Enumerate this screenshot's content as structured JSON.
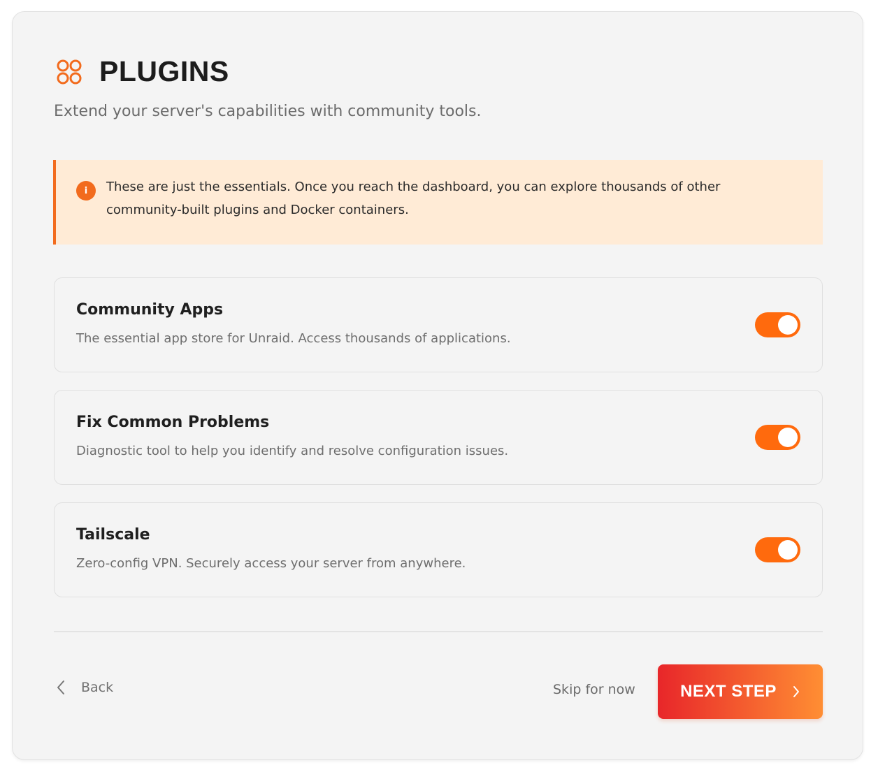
{
  "header": {
    "title": "PLUGINS",
    "icon": "apps-grid-icon",
    "subtitle": "Extend your server's capabilities with community tools."
  },
  "notice": {
    "icon": "info-icon",
    "icon_glyph": "i",
    "text": "These are just the essentials. Once you reach the dashboard, you can explore thousands of other community-built plugins and Docker containers."
  },
  "plugins": [
    {
      "name": "Community Apps",
      "description": "The essential app store for Unraid. Access thousands of applications.",
      "enabled": true
    },
    {
      "name": "Fix Common Problems",
      "description": "Diagnostic tool to help you identify and resolve configuration issues.",
      "enabled": true
    },
    {
      "name": "Tailscale",
      "description": "Zero-config VPN. Securely access your server from anywhere.",
      "enabled": true
    }
  ],
  "footer": {
    "back_label": "Back",
    "skip_label": "Skip for now",
    "next_label": "NEXT STEP"
  },
  "colors": {
    "accent": "#ff6a0d",
    "notice_bg": "#ffebd6",
    "gradient_start": "#e8262a",
    "gradient_end": "#ff8e33"
  }
}
